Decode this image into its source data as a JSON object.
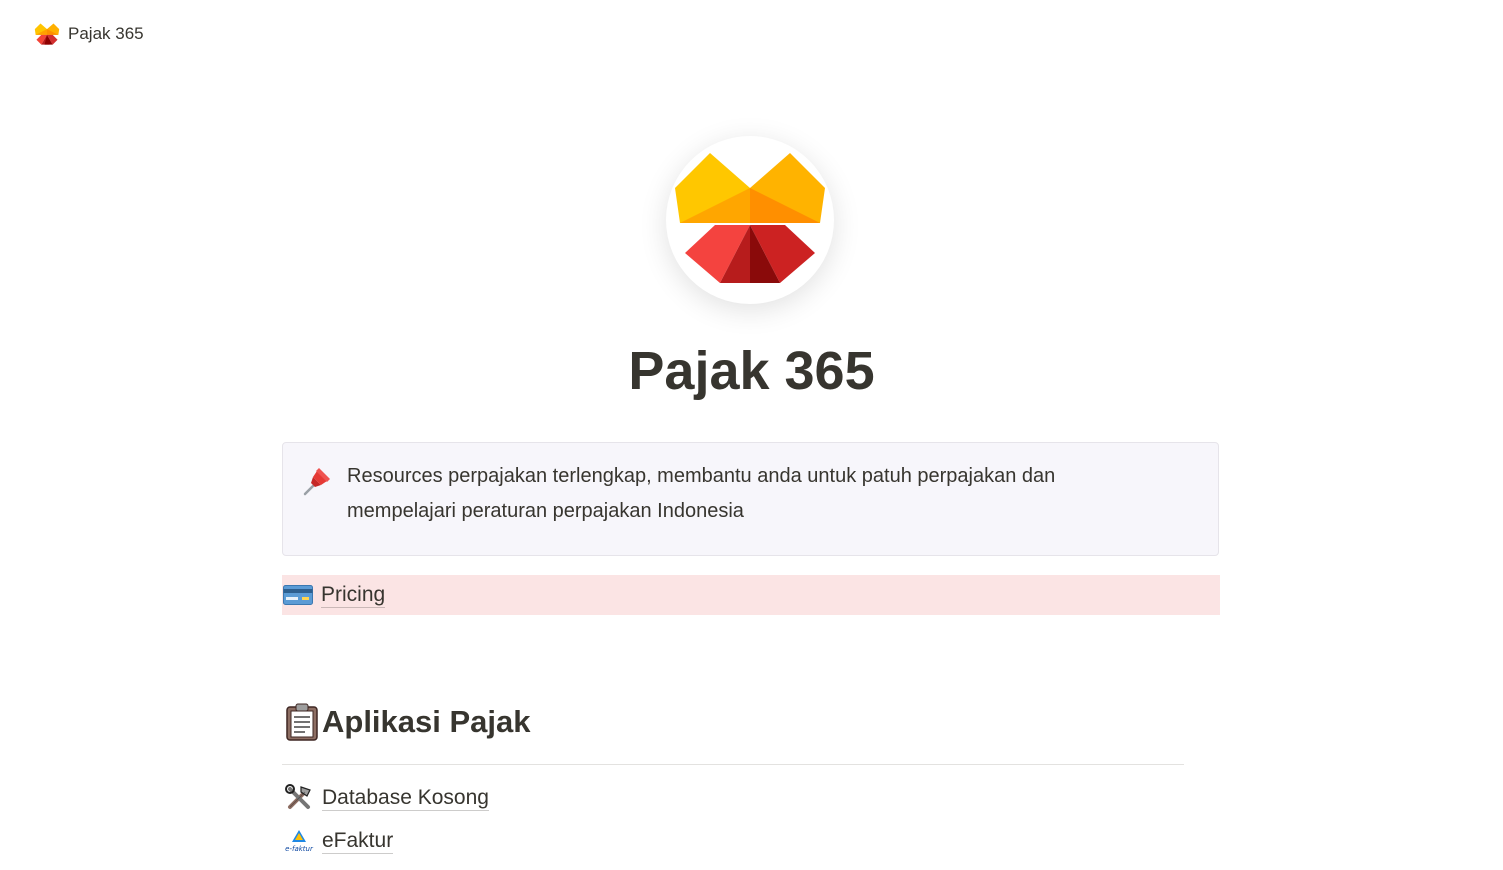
{
  "breadcrumb": {
    "icon": "butterfly-logo-icon",
    "label": "Pajak 365"
  },
  "page": {
    "title": "Pajak 365",
    "logo_icon": "butterfly-logo-icon"
  },
  "callout": {
    "icon": "pushpin-icon",
    "text": "Resources perpajakan terlengkap, membantu anda untuk patuh perpajakan dan mempelajari peraturan perpajakan Indonesia",
    "background": "#f7f6fb"
  },
  "pricing": {
    "icon": "credit-card-icon",
    "label": "Pricing",
    "background": "#fbe4e4"
  },
  "section": {
    "icon": "clipboard-icon",
    "heading": "Aplikasi Pajak"
  },
  "links": [
    {
      "icon": "tools-icon",
      "label": "Database Kosong"
    },
    {
      "icon": "efaktur-logo-icon",
      "label": "eFaktur",
      "icon_text": "e-faktur"
    }
  ],
  "colors": {
    "text": "#37352f",
    "logo_yellow": "#ffc400",
    "logo_orange": "#ff9800",
    "logo_red": "#e53935",
    "logo_dark_red": "#b71c1c"
  }
}
